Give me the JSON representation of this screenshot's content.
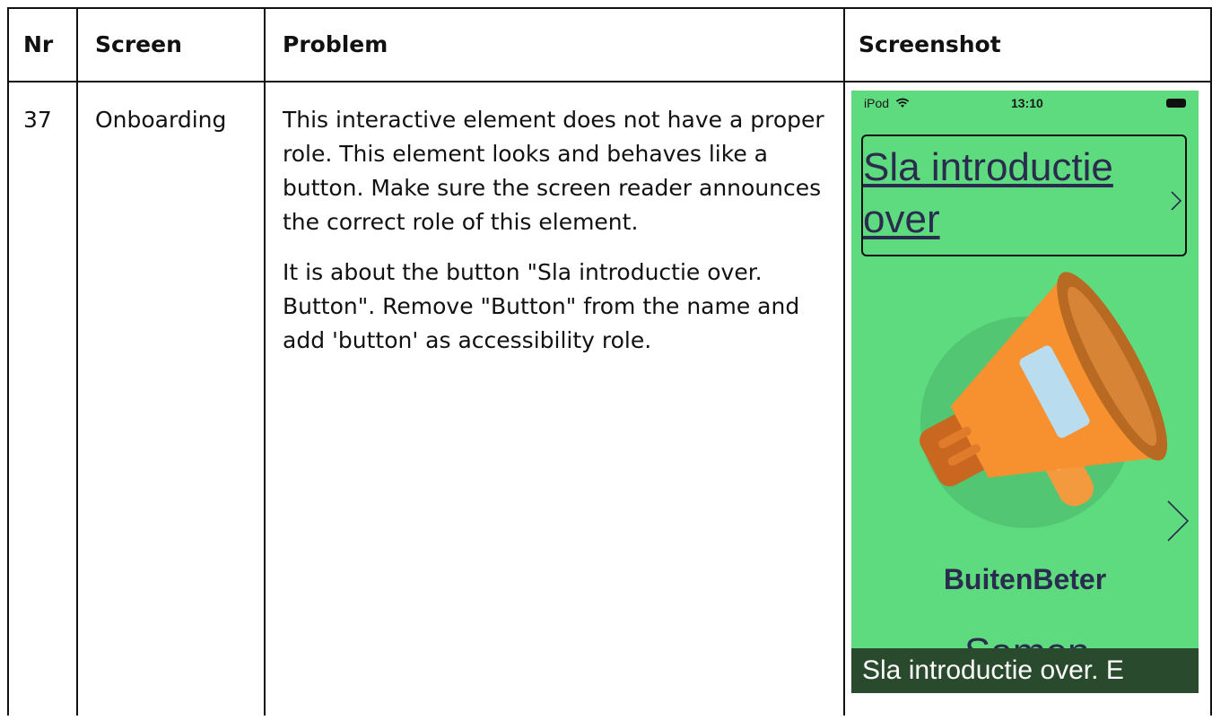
{
  "table": {
    "headers": {
      "nr": "Nr",
      "screen": "Screen",
      "problem": "Problem",
      "screenshot": "Screenshot"
    },
    "row": {
      "nr": "37",
      "screen": "Onboarding",
      "problem_p1": "This interactive element does not have a proper role. This element looks and behaves like a button. Make sure the screen reader announces the correct role of this element.",
      "problem_p2": "It is about the button \"Sla introductie over. Button\". Remove \"Button\" from the name and add 'button' as accessibility role."
    }
  },
  "screenshot": {
    "status_device": "iPod",
    "status_time": "13:10",
    "skip_button_label": "Sla introductie over",
    "brand_title": "BuitenBeter",
    "partial_text": "Samen",
    "voiceover_caption": "Sla introductie over. E",
    "colors": {
      "background": "#5fdb7f",
      "circle": "#52c672",
      "megaphone": "#f7912f",
      "caption_bg": "#2a4a2e",
      "text": "#2a2c4d"
    },
    "icons": [
      "wifi-icon",
      "battery-icon",
      "chevron-right-icon",
      "megaphone-illustration"
    ]
  }
}
